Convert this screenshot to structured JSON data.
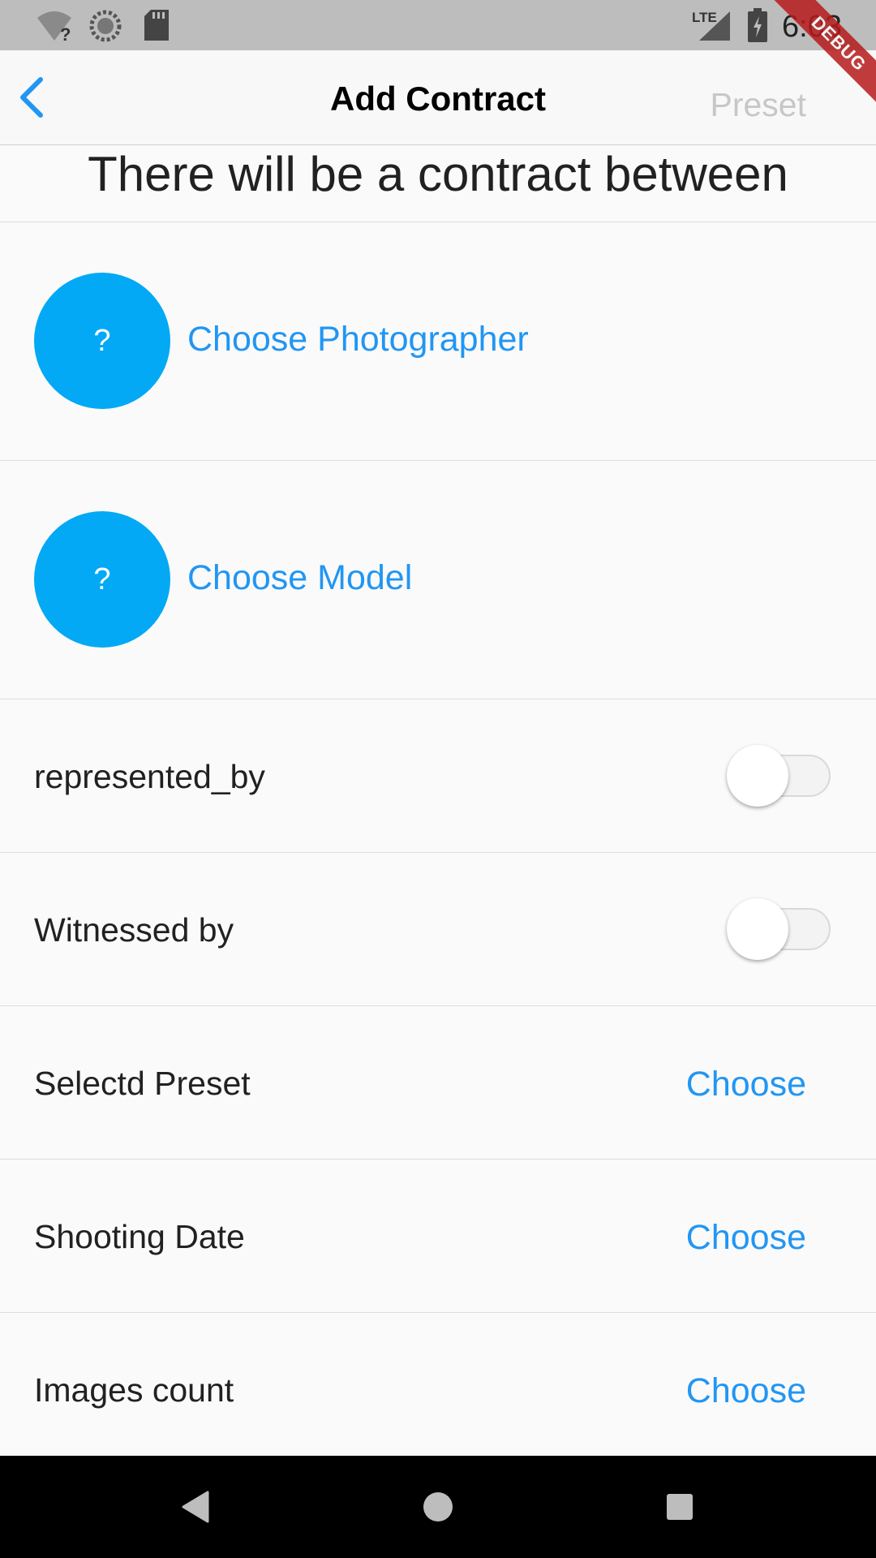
{
  "status_bar": {
    "time": "6:03",
    "network_label": "LTE",
    "icons": [
      "wifi-unknown-icon",
      "sync-icon",
      "sd-card-icon",
      "lte-signal-icon",
      "battery-charging-icon"
    ]
  },
  "debug_banner": {
    "label": "DEBUG",
    "color": "#b71c1c"
  },
  "app_bar": {
    "back_icon": "chevron-left-icon",
    "title": "Add Contract",
    "action_label": "Preset"
  },
  "intro": "There will be a contract between",
  "parties": [
    {
      "avatar_text": "?",
      "label": "Choose Photographer"
    },
    {
      "avatar_text": "?",
      "label": "Choose Model"
    }
  ],
  "toggles": [
    {
      "label": "represented_by",
      "on": false
    },
    {
      "label": "Witnessed by",
      "on": false
    }
  ],
  "choices": [
    {
      "label": "Selectd Preset",
      "action": "Choose"
    },
    {
      "label": "Shooting Date",
      "action": "Choose"
    },
    {
      "label": "Images count",
      "action": "Choose"
    }
  ],
  "nav_bar": {
    "icons": [
      "back-triangle-icon",
      "home-circle-icon",
      "recents-square-icon"
    ]
  },
  "colors": {
    "accent": "#2196f3",
    "avatar": "#03a9f4",
    "status_bar": "#bdbdbd",
    "background": "#fafafa"
  }
}
